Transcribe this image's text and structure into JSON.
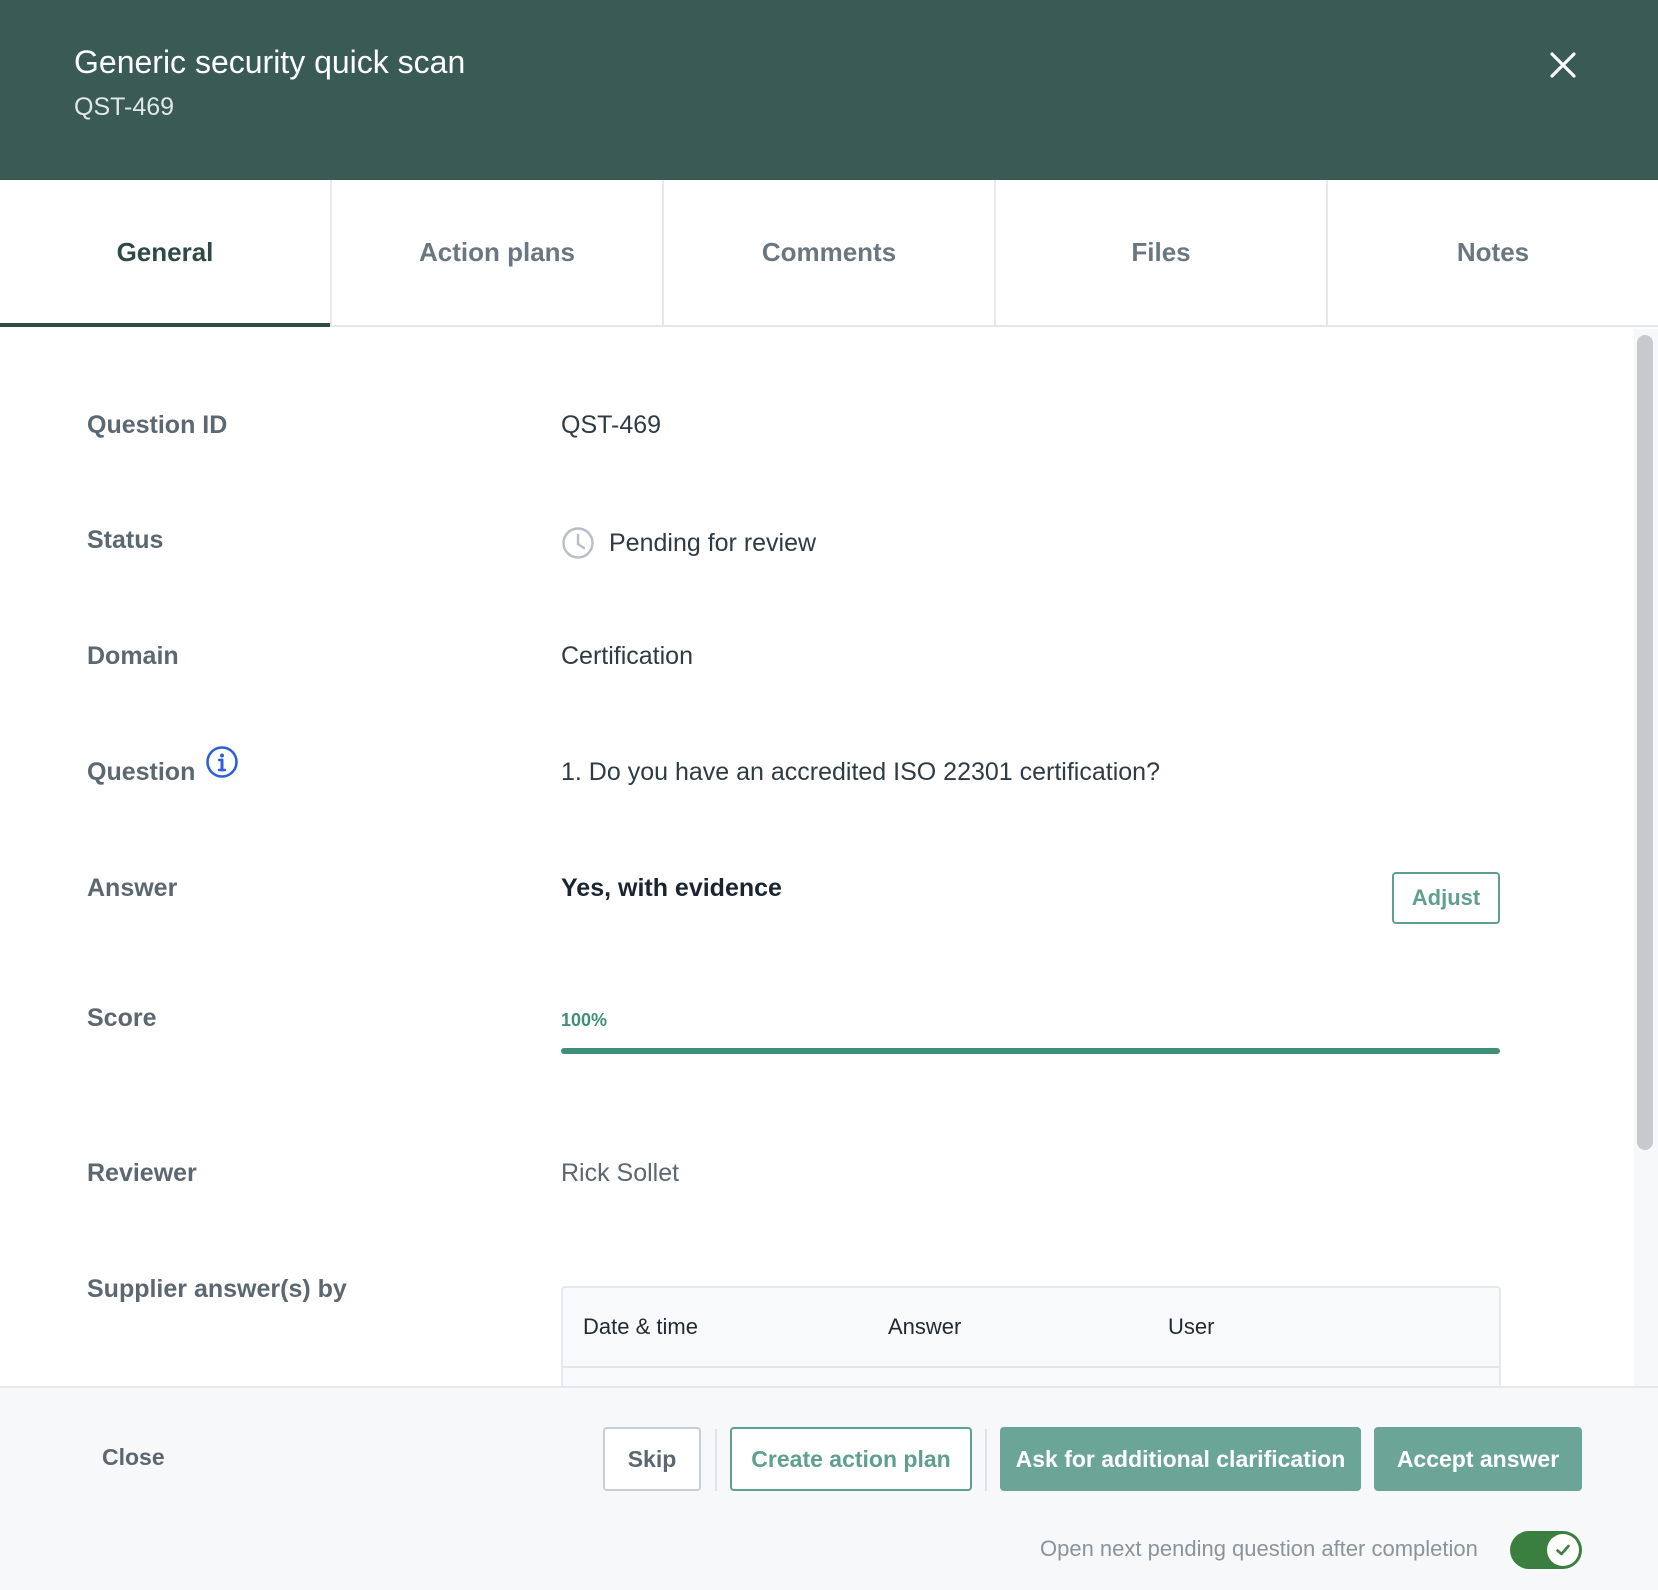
{
  "header": {
    "title": "Generic security quick scan",
    "subtitle": "QST-469"
  },
  "tabs": [
    {
      "label": "General",
      "active": true
    },
    {
      "label": "Action plans",
      "active": false
    },
    {
      "label": "Comments",
      "active": false
    },
    {
      "label": "Files",
      "active": false
    },
    {
      "label": "Notes",
      "active": false
    }
  ],
  "fields": {
    "question_id": {
      "label": "Question ID",
      "value": "QST-469"
    },
    "status": {
      "label": "Status",
      "value": "Pending for review",
      "icon": "clock-icon"
    },
    "domain": {
      "label": "Domain",
      "value": "Certification"
    },
    "question": {
      "label": "Question",
      "value": "1. Do you have an accredited ISO 22301 certification?",
      "icon": "info-icon"
    },
    "answer": {
      "label": "Answer",
      "value": "Yes, with evidence",
      "adjust_label": "Adjust"
    },
    "score": {
      "label": "Score",
      "value_text": "100%",
      "percent": 100
    },
    "reviewer": {
      "label": "Reviewer",
      "value": "Rick Sollet"
    },
    "supplier": {
      "label": "Supplier answer(s) by"
    }
  },
  "supplier_table": {
    "columns": [
      "Date & time",
      "Answer",
      "User"
    ]
  },
  "footer": {
    "close_label": "Close",
    "skip_label": "Skip",
    "create_action_plan_label": "Create action plan",
    "ask_clarification_label": "Ask for additional clarification",
    "accept_answer_label": "Accept answer",
    "toggle_label": "Open next pending question after completion",
    "toggle_on": true
  },
  "colors": {
    "header_bg": "#3a5a54",
    "accent": "#5f9f8f",
    "score": "#3f8f79",
    "toggle": "#3a7f3f"
  }
}
